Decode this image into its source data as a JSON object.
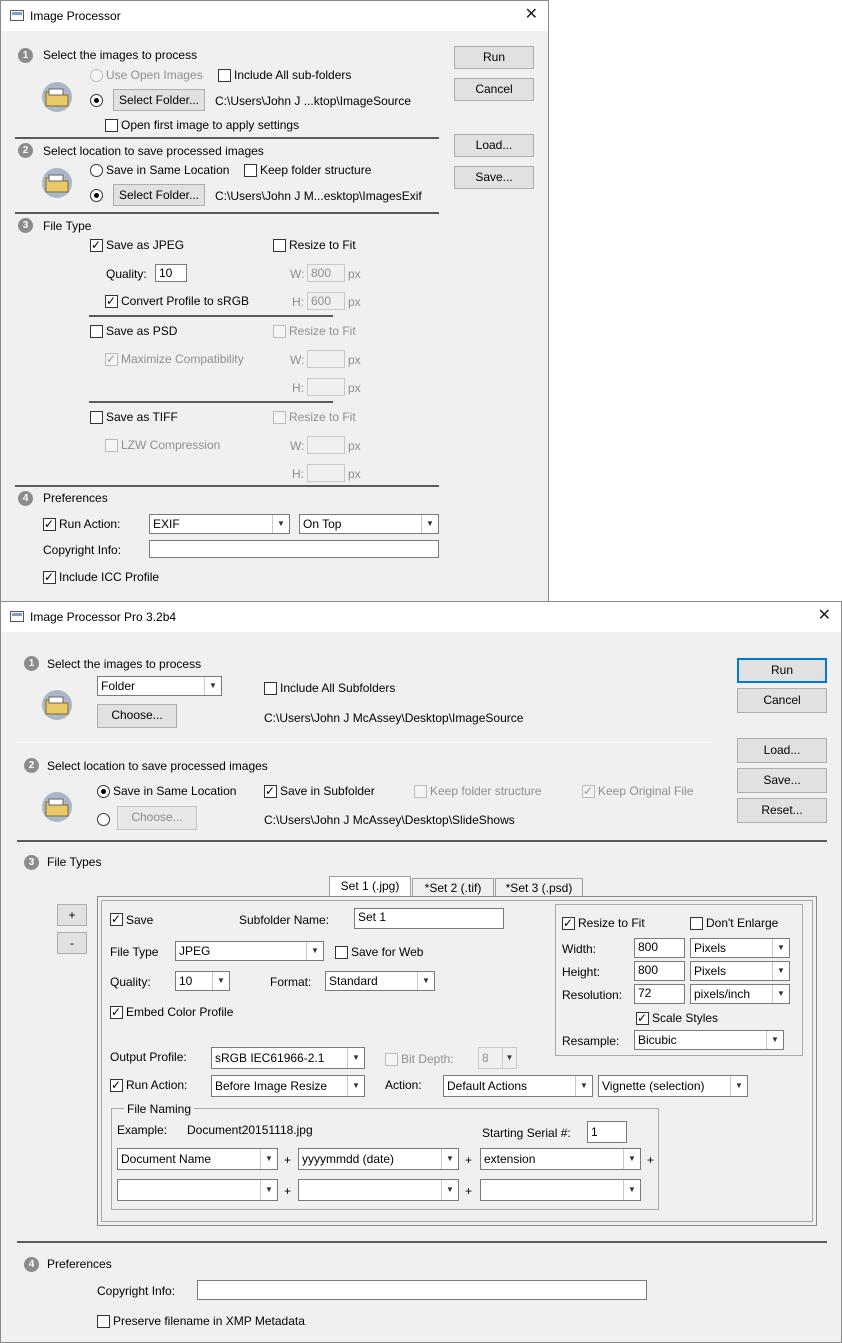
{
  "win1": {
    "title": "Image Processor",
    "step1": "Select the images to process",
    "use_open": "Use Open Images",
    "include_sub": "Include All sub-folders",
    "select_folder": "Select Folder...",
    "src_path": "C:\\Users\\John J ...ktop\\ImageSource",
    "open_first": "Open first image to apply settings",
    "step2": "Select location to save processed images",
    "save_same": "Save in Same Location",
    "keep_struct": "Keep folder structure",
    "dst_path": "C:\\Users\\John J M...esktop\\ImagesExif",
    "step3": "File Type",
    "save_jpeg": "Save as JPEG",
    "resize_fit": "Resize to Fit",
    "quality_label": "Quality:",
    "quality": "10",
    "w_label": "W:",
    "h_label": "H:",
    "px": "px",
    "jpeg_w": "800",
    "jpeg_h": "600",
    "convert_srgb": "Convert Profile to sRGB",
    "save_psd": "Save as PSD",
    "max_compat": "Maximize Compatibility",
    "save_tiff": "Save as TIFF",
    "lzw": "LZW Compression",
    "step4": "Preferences",
    "run_action": "Run Action:",
    "action_set": "EXIF",
    "action": "On Top",
    "copyright": "Copyright Info:",
    "copyright_value": "",
    "icc": "Include ICC Profile",
    "run": "Run",
    "cancel": "Cancel",
    "load": "Load...",
    "save": "Save..."
  },
  "win2": {
    "title": "Image Processor Pro 3.2b4",
    "step1": "Select the images to process",
    "source": "Folder",
    "include_sub": "Include All Subfolders",
    "choose": "Choose...",
    "src_path": "C:\\Users\\John J McAssey\\Desktop\\ImageSource",
    "step2": "Select location to save processed images",
    "save_same": "Save in Same Location",
    "save_sub": "Save in Subfolder",
    "keep_struct": "Keep folder structure",
    "keep_orig": "Keep Original File",
    "dst_path": "C:\\Users\\John J McAssey\\Desktop\\SlideShows",
    "step3": "File Types",
    "tabs": [
      "Set 1 (.jpg)",
      "*Set 2 (.tif)",
      "*Set 3 (.psd)"
    ],
    "plus": "+",
    "minus": "-",
    "save": "Save",
    "subfolder_label": "Subfolder Name:",
    "subfolder": "Set 1",
    "filetype_label": "File Type",
    "filetype": "JPEG",
    "save_web": "Save for Web",
    "quality_label": "Quality:",
    "quality": "10",
    "format_label": "Format:",
    "format": "Standard",
    "embed": "Embed Color Profile",
    "resize_fit": "Resize to Fit",
    "dont_enlarge": "Don't Enlarge",
    "width_label": "Width:",
    "width": "800",
    "width_unit": "Pixels",
    "height_label": "Height:",
    "height": "800",
    "height_unit": "Pixels",
    "res_label": "Resolution:",
    "res": "72",
    "res_unit": "pixels/inch",
    "scale_styles": "Scale Styles",
    "resample_label": "Resample:",
    "resample": "Bicubic",
    "profile_label": "Output Profile:",
    "profile": "sRGB IEC61966-2.1",
    "bitdepth_label": "Bit Depth:",
    "bitdepth": "8",
    "run_action": "Run Action:",
    "run_when": "Before Image Resize",
    "action_label": "Action:",
    "action_set": "Default Actions",
    "action": "Vignette (selection)",
    "naming_title": "File Naming",
    "example_label": "Example:",
    "example": "Document20151118.jpg",
    "serial_label": "Starting Serial #:",
    "serial": "1",
    "naming1": "Document Name",
    "naming2": "yyyymmdd (date)",
    "naming3": "extension",
    "plus_sign": "+",
    "step4": "Preferences",
    "copyright": "Copyright Info:",
    "copyright_value": "",
    "preserve": "Preserve filename in XMP Metadata",
    "run": "Run",
    "cancel": "Cancel",
    "load": "Load...",
    "save_btn": "Save...",
    "reset": "Reset..."
  }
}
